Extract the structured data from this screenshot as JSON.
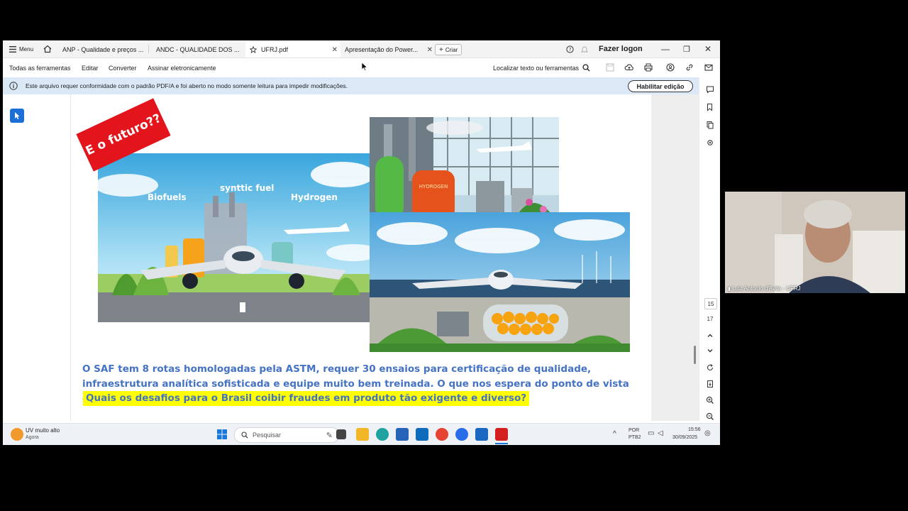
{
  "tabbar": {
    "menu_label": "Menu",
    "tabs": [
      {
        "label": "ANP - Qualidade e preços ..."
      },
      {
        "label": "ANDC - QUALIDADE DOS ..."
      },
      {
        "label": "UFRJ.pdf"
      },
      {
        "label": "Apresentação do Power..."
      }
    ],
    "create_label": "Criar",
    "signin_label": "Fazer logon"
  },
  "menubar": {
    "all_tools": "Todas as ferramentas",
    "edit": "Editar",
    "convert": "Converter",
    "sign": "Assinar eletronicamente",
    "find": "Localizar texto ou ferramentas"
  },
  "banner": {
    "message": "Este arquivo requer conformidade com o padrão PDF/A e foi aberto no modo somente leitura para impedir modificações.",
    "enable_button": "Habilitar edição"
  },
  "page_nav": {
    "current": "15",
    "total": "17"
  },
  "slide": {
    "red_label": "E o futuro??",
    "img1_biofuels": "Biofuels",
    "img1_synfuel": "synttic fuel",
    "img1_hydrogen": "Hydrogen",
    "img2_tank": "HYDROGEN",
    "paragraph": "O SAF tem  8 rotas homologadas pela ASTM, requer  30 ensaios para certificação de qualidade, infraestrutura analítica sofisticada e equipe muito bem treinada. O que nos espera do ponto de vista da qualidade?",
    "highlight": "Quais os desafios para o Brasil coibir fraudes em produto tão exigente e diverso?"
  },
  "taskbar": {
    "weather_title": "UV muito alto",
    "weather_sub": "Agora",
    "search_placeholder": "Pesquisar",
    "lang_top": "POR",
    "lang_bottom": "PTB2",
    "time": "15:56",
    "date": "30/09/2025"
  },
  "webcam": {
    "name": "Luiz Antonio d'Avila - UFRJ"
  },
  "colors": {
    "accent": "#1b6fd6",
    "banner": "#dbe9f7",
    "slide_text": "#4472c4",
    "highlight": "#ffff00",
    "red_label": "#e3141b"
  }
}
